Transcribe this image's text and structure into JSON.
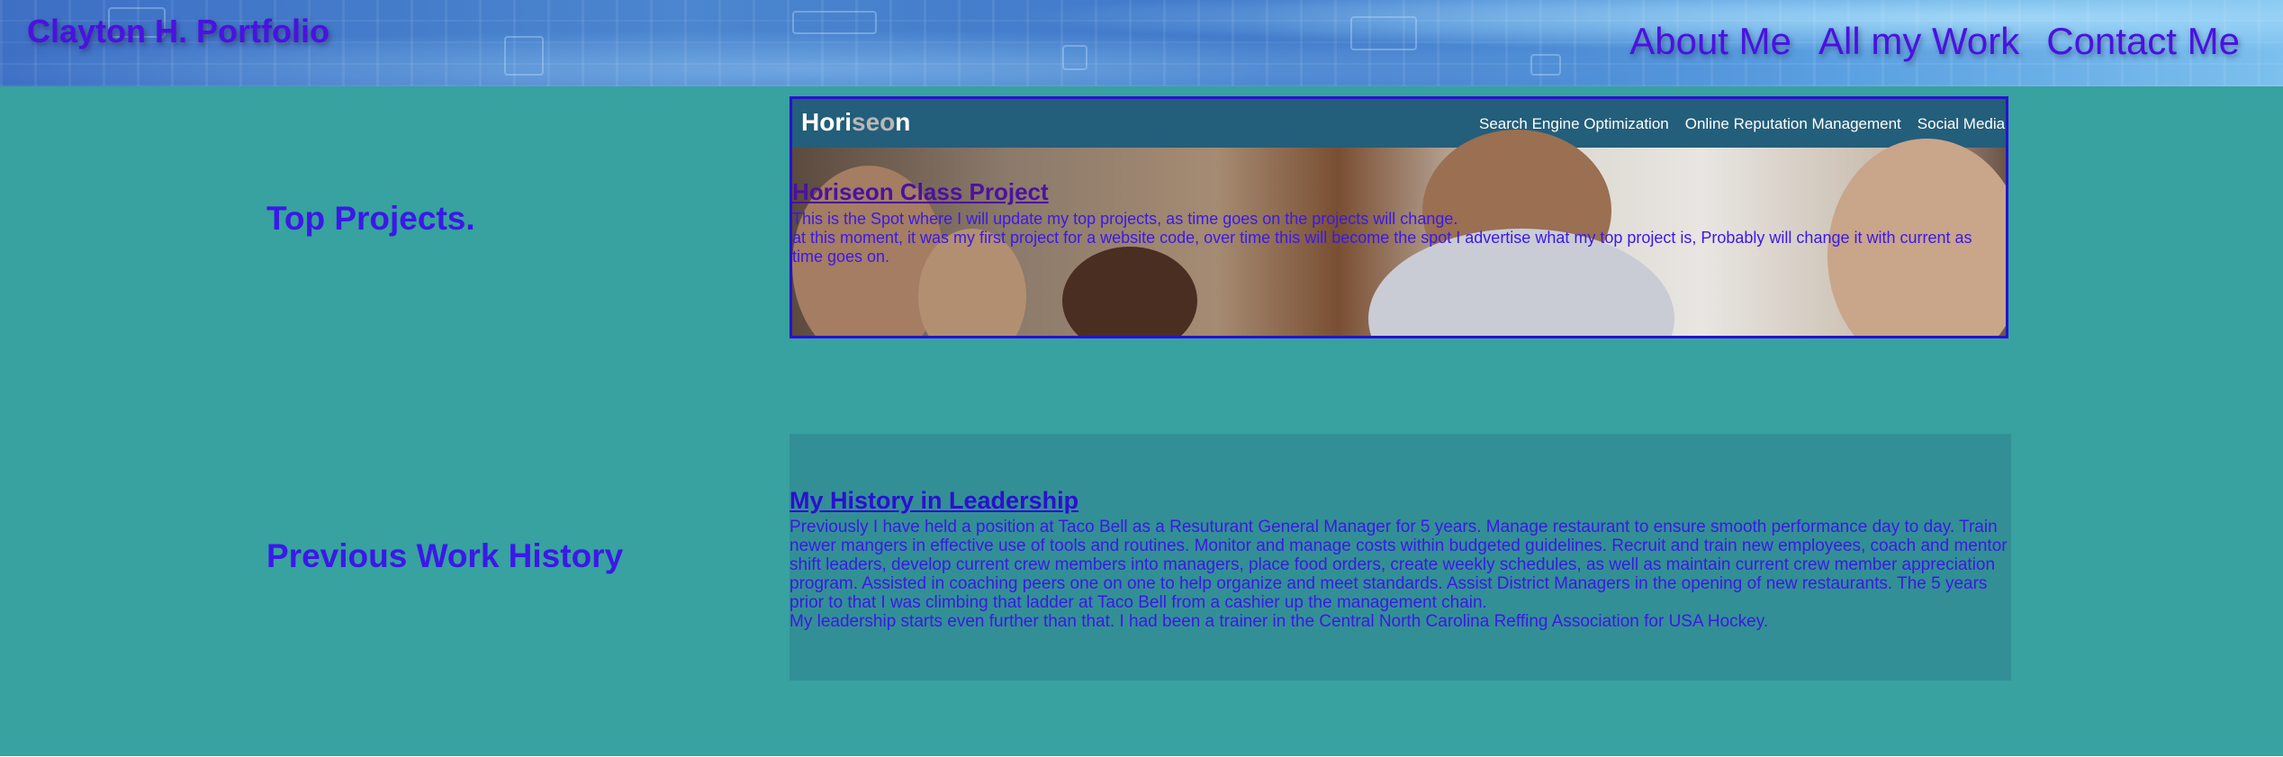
{
  "header": {
    "title": "Clayton H. Portfolio",
    "nav": [
      "About Me",
      "All my Work",
      "Contact Me"
    ]
  },
  "sections": {
    "top_projects_heading": "Top Projects.",
    "work_history_heading": "Previous Work History"
  },
  "project_card": {
    "preview": {
      "logo_a": "Hori",
      "logo_b": "seo",
      "logo_c": "n",
      "links": [
        "Search Engine Optimization",
        "Online Reputation Management",
        "Social Media Ma"
      ]
    },
    "title": "Horiseon Class Project",
    "body_line1": "This is the Spot where I will update my top projects, as time goes on the projects will change.",
    "body_line2": "at this moment, it was my first project for a website code, over time this will become the spot I advertise what my top project is, Probably will change it with current as time goes on."
  },
  "history": {
    "title": "My History in Leadership",
    "para1": "Previously I have held a position at Taco Bell as a Resuturant General Manager for 5 years. Manage restaurant to ensure smooth performance day to day. Train newer mangers in effective use of tools and routines. Monitor and manage costs within budgeted guidelines. Recruit and train new employees, coach and mentor shift leaders, develop current crew members into managers, place food orders, create weekly schedules, as well as maintain current crew member appreciation program. Assisted in coaching peers one on one to help organize and meet standards. Assist District Managers in the opening of new restaurants. The 5 years prior to that I was climbing that ladder at Taco Bell from a cashier up the management chain.",
    "para2": "My leadership starts even further than that. I had been a trainer in the Central North Carolina Reffing Association for USA Hockey."
  }
}
